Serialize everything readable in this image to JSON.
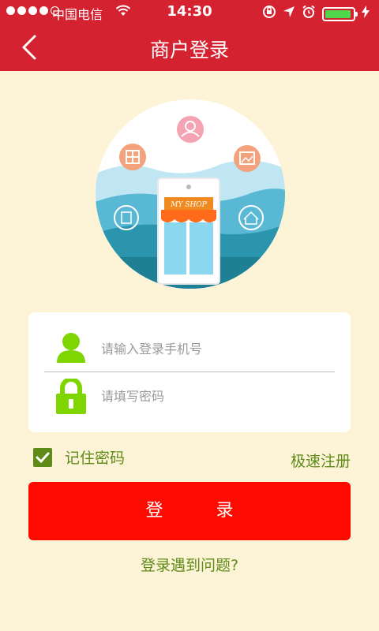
{
  "status_bar": {
    "carrier": "中国电信",
    "time": "14:30",
    "battery_level": 0.95
  },
  "navbar": {
    "title": "商户登录",
    "back_icon": "chevron-left-icon"
  },
  "illustration": {
    "shop_sign": "MY SHOP"
  },
  "form": {
    "phone_placeholder": "请输入登录手机号",
    "password_placeholder": "请填写密码",
    "phone_icon": "user-icon",
    "password_icon": "lock-icon"
  },
  "options": {
    "remember_label": "记住密码",
    "remember_checked": true,
    "register_label": "极速注册"
  },
  "login_button": "登 录",
  "help_link": "登录遇到问题?",
  "colors": {
    "header": "#d42230",
    "background": "#fdf3d6",
    "accent_green": "#5e8b18",
    "button_red": "#fe0a00",
    "icon_green": "#7fd500"
  }
}
